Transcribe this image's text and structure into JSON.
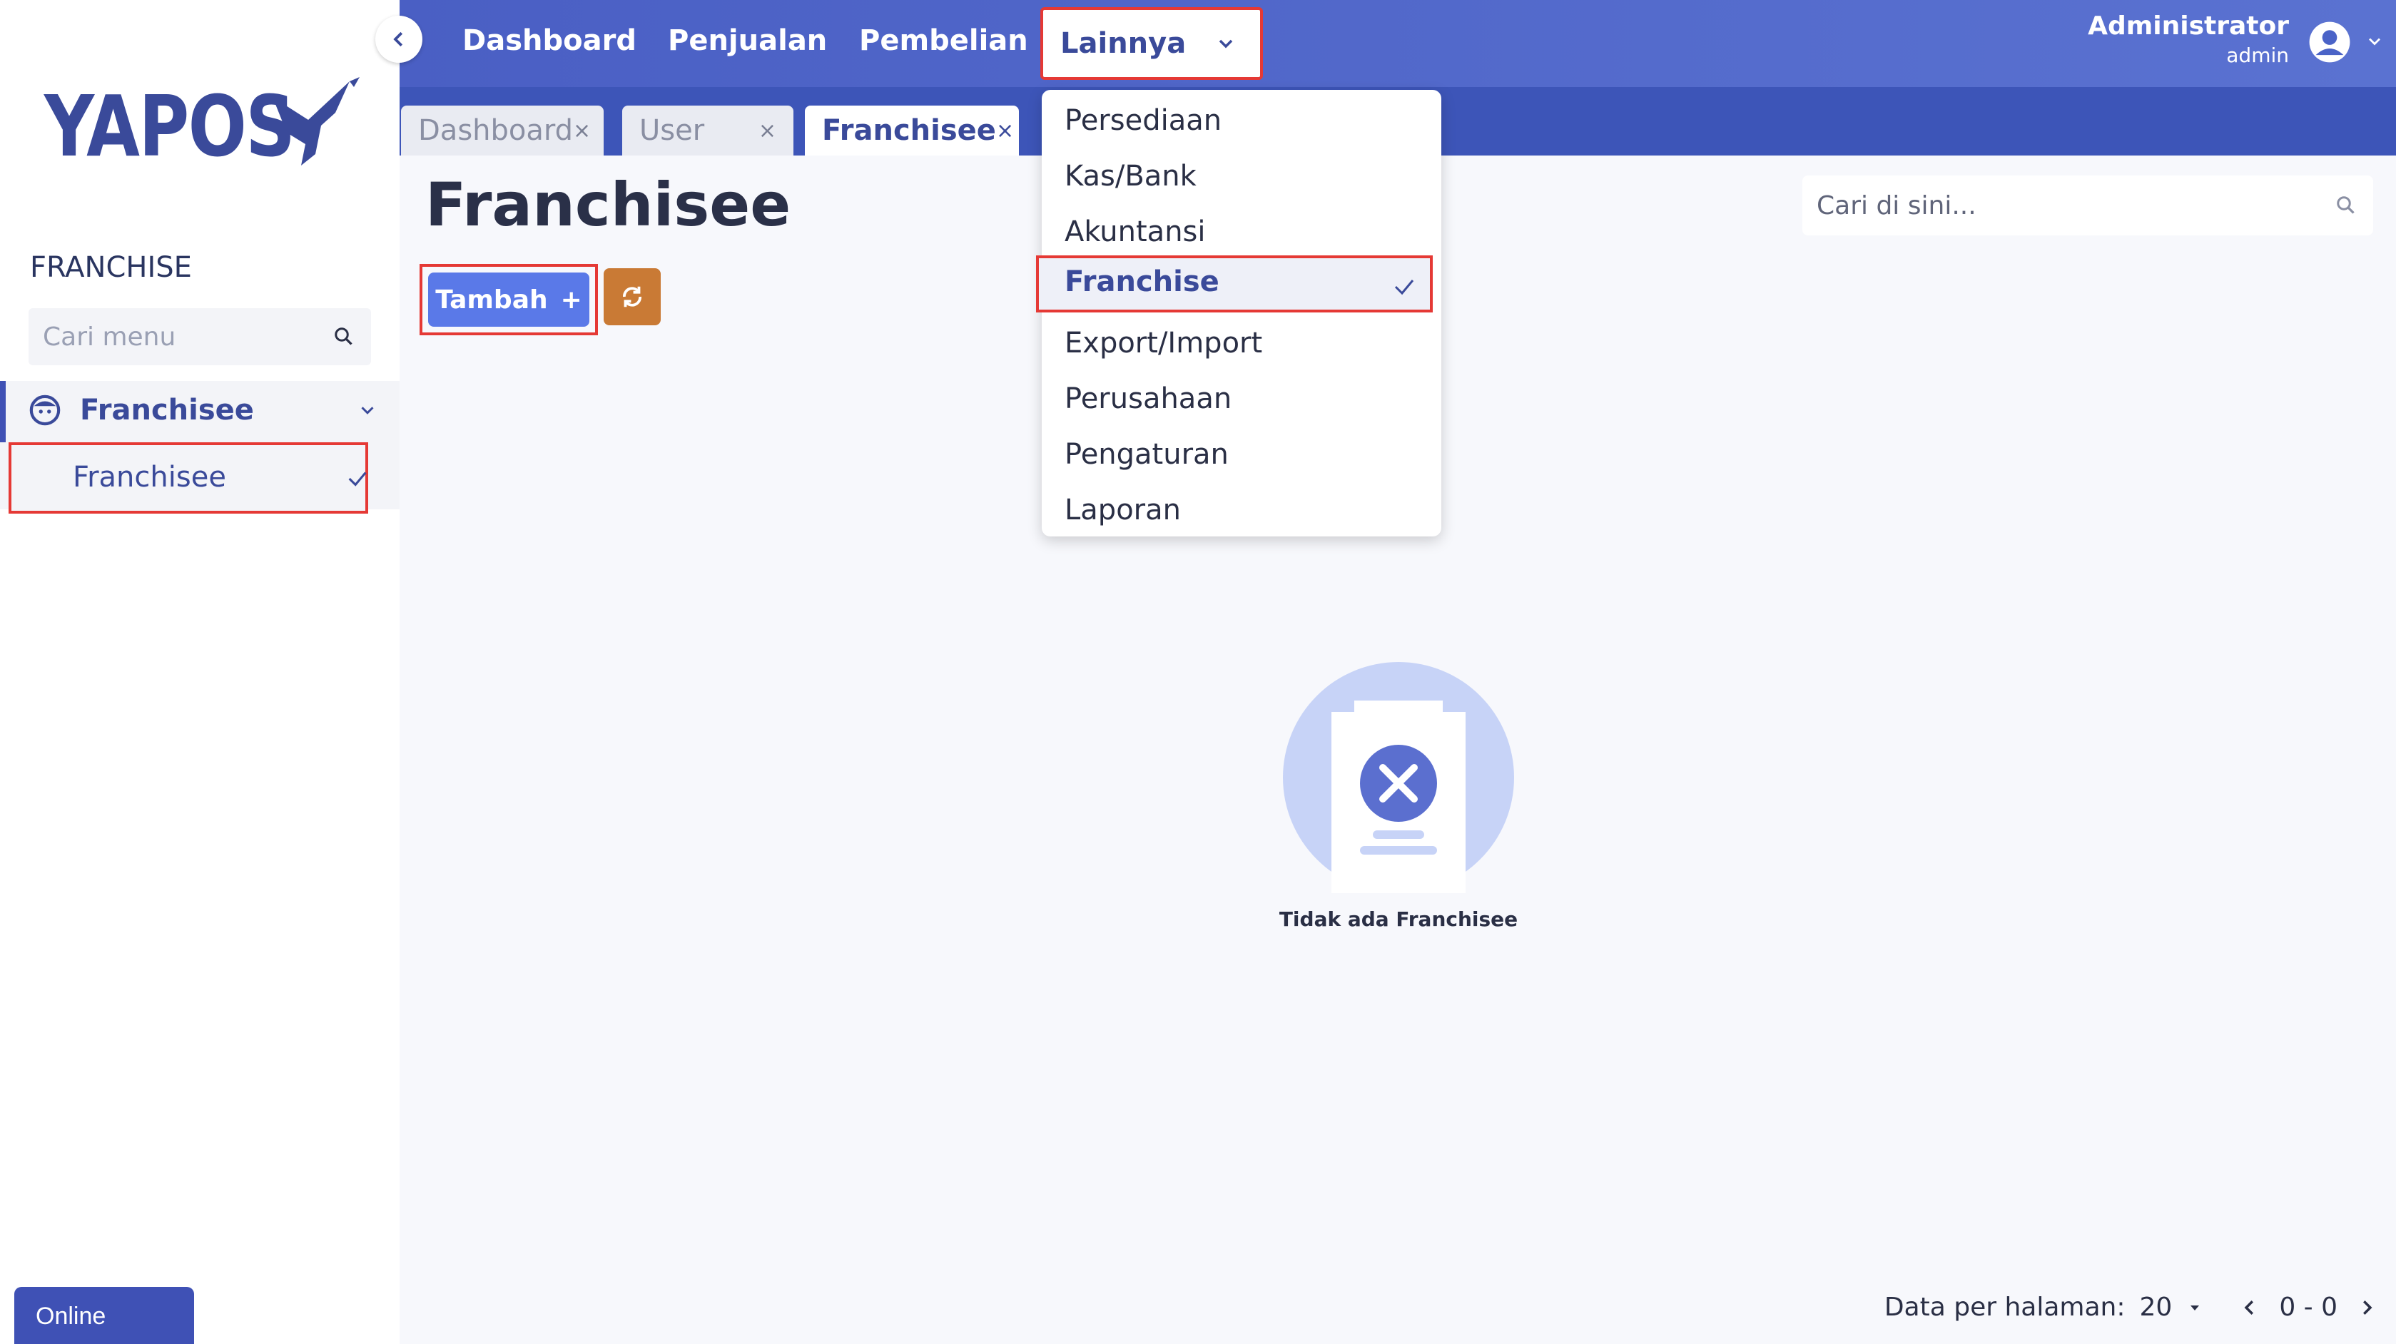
{
  "sidebar": {
    "logo_text": "YAPOS",
    "section_title": "FRANCHISE",
    "search_placeholder": "Cari menu",
    "group_label": "Franchisee",
    "sub_item_label": "Franchisee",
    "status_button": "Online"
  },
  "topbar": {
    "nav": [
      "Dashboard",
      "Penjualan",
      "Pembelian"
    ],
    "more_label": "Lainnya",
    "user_name": "Administrator",
    "user_role": "admin"
  },
  "tabs": [
    {
      "label": "Dashboard",
      "close": "×"
    },
    {
      "label": "User",
      "close": "×"
    },
    {
      "label": "Franchisee",
      "close": "×",
      "active": true
    }
  ],
  "dropdown": {
    "items": [
      "Persediaan",
      "Kas/Bank",
      "Akuntansi",
      "Franchise",
      "Export/Import",
      "Perusahaan",
      "Pengaturan",
      "Laporan"
    ],
    "selected": "Franchise"
  },
  "main": {
    "title": "Franchisee",
    "add_button": "Tambah",
    "add_icon": "+",
    "search_placeholder": "Cari di sini...",
    "empty_text": "Tidak ada Franchisee"
  },
  "pager": {
    "per_page_label": "Data per halaman:",
    "per_page_value": "20",
    "range": "0 - 0"
  },
  "colors": {
    "primary": "#3f51b5",
    "topbar": "#4a63c7",
    "add_button": "#5a79e8",
    "refresh_button": "#c97a35",
    "highlight": "#e53935"
  }
}
